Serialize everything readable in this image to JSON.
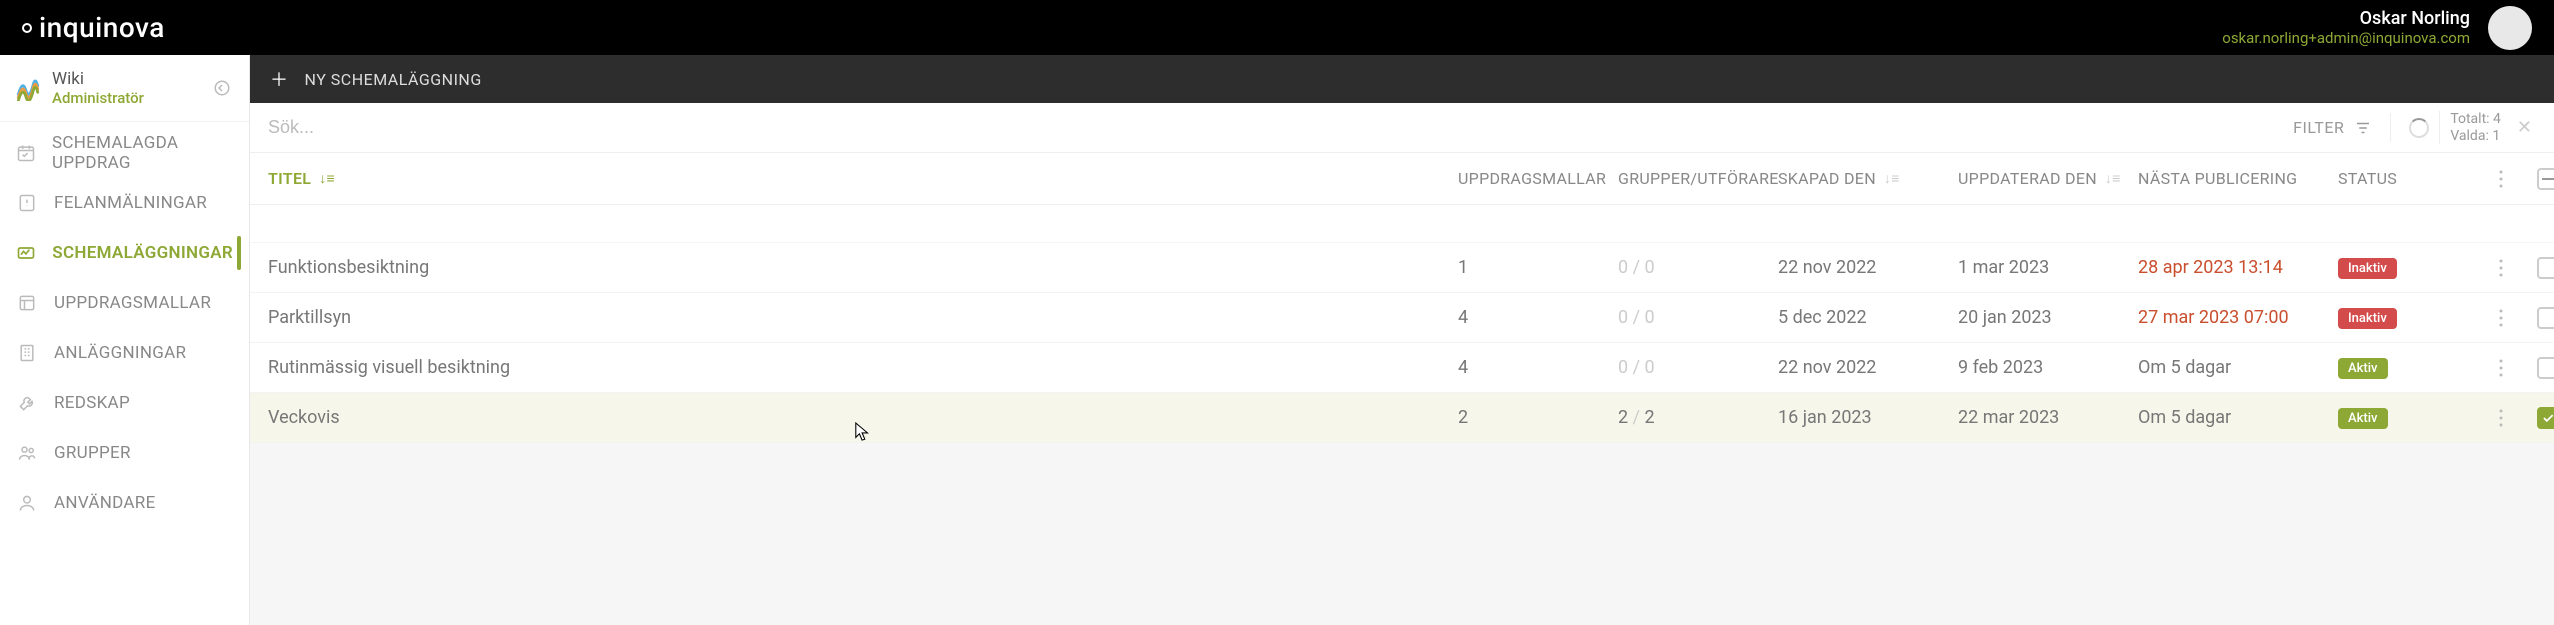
{
  "brand": "inquinova",
  "user": {
    "name": "Oskar Norling",
    "email": "oskar.norling+admin@inquinova.com"
  },
  "sidebar": {
    "app_title": "Wiki",
    "app_role": "Administratör",
    "items": [
      {
        "label": "SCHEMALAGDA UPPDRAG"
      },
      {
        "label": "FELANMÄLNINGAR"
      },
      {
        "label": "SCHEMALÄGGNINGAR"
      },
      {
        "label": "UPPDRAGSMALLAR"
      },
      {
        "label": "ANLÄGGNINGAR"
      },
      {
        "label": "REDSKAP"
      },
      {
        "label": "GRUPPER"
      },
      {
        "label": "ANVÄNDARE"
      }
    ]
  },
  "actions": {
    "new_label": "NY SCHEMALÄGGNING"
  },
  "toolbar": {
    "search_placeholder": "Sök...",
    "filter_label": "FILTER",
    "total_label": "Totalt:",
    "total_value": "4",
    "selected_label": "Valda:",
    "selected_value": "1"
  },
  "columns": {
    "title": "TITEL",
    "templates": "UPPDRAGSMALLAR",
    "groups": "GRUPPER/UTFÖRARE",
    "created": "SKAPAD DEN",
    "updated": "UPPDATERAD DEN",
    "next_pub": "NÄSTA PUBLICERING",
    "status": "STATUS"
  },
  "rows": [
    {
      "title": "Funktionsbesiktning",
      "templates": "1",
      "groups_a": "0",
      "groups_b": "0",
      "created": "22 nov 2022",
      "updated": "1 mar 2023",
      "next": "28 apr 2023 13:14",
      "next_overdue": true,
      "status": "Inaktiv",
      "status_kind": "inaktiv",
      "selected": false
    },
    {
      "title": "Parktillsyn",
      "templates": "4",
      "groups_a": "0",
      "groups_b": "0",
      "created": "5 dec 2022",
      "updated": "20 jan 2023",
      "next": "27 mar 2023 07:00",
      "next_overdue": true,
      "status": "Inaktiv",
      "status_kind": "inaktiv",
      "selected": false
    },
    {
      "title": "Rutinmässig visuell besiktning",
      "templates": "4",
      "groups_a": "0",
      "groups_b": "0",
      "created": "22 nov 2022",
      "updated": "9 feb 2023",
      "next": "Om 5 dagar",
      "next_overdue": false,
      "status": "Aktiv",
      "status_kind": "aktiv",
      "selected": false
    },
    {
      "title": "Veckovis",
      "templates": "2",
      "groups_a": "2",
      "groups_b": "2",
      "created": "16 jan 2023",
      "updated": "22 mar 2023",
      "next": "Om 5 dagar",
      "next_overdue": false,
      "status": "Aktiv",
      "status_kind": "aktiv",
      "selected": true
    }
  ]
}
